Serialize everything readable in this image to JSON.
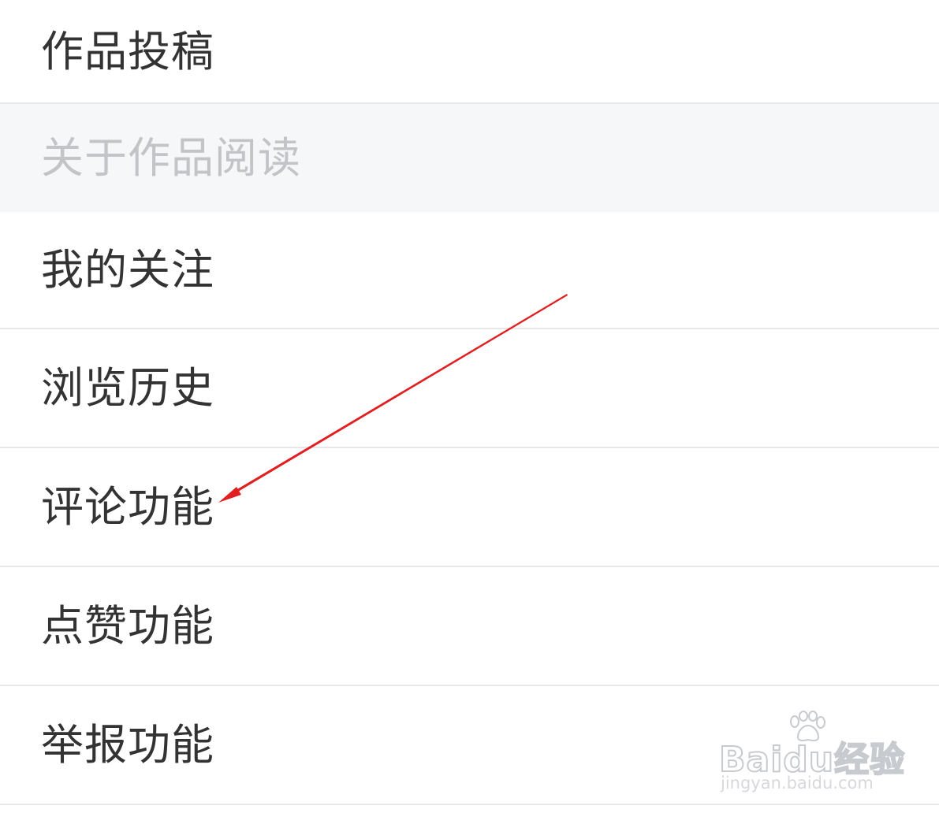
{
  "menu": {
    "items": [
      {
        "label": "作品投稿"
      },
      {
        "label": "我的关注"
      },
      {
        "label": "浏览历史"
      },
      {
        "label": "评论功能"
      },
      {
        "label": "点赞功能"
      },
      {
        "label": "举报功能"
      }
    ],
    "section_header": "关于作品阅读"
  },
  "annotation": {
    "arrow_color": "#e02020",
    "target": "评论功能"
  },
  "watermark": {
    "brand": "Baidu经验",
    "url": "jingyan.baidu.com"
  },
  "colors": {
    "text": "#333333",
    "section_text": "#c2c4c8",
    "section_bg": "#f6f7f9",
    "divider": "#e8e8ea"
  }
}
